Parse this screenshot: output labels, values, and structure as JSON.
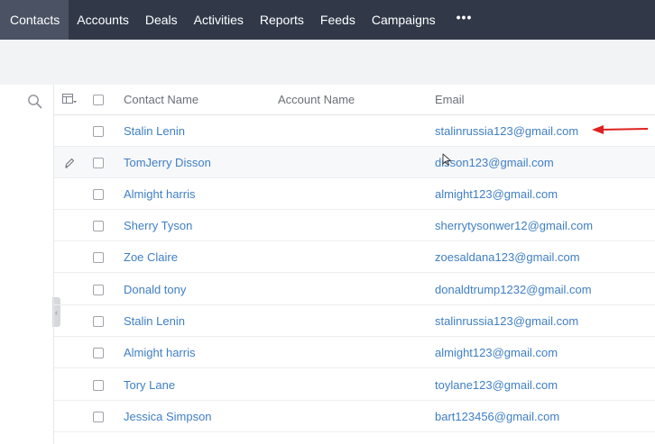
{
  "nav": {
    "items": [
      "Contacts",
      "Accounts",
      "Deals",
      "Activities",
      "Reports",
      "Feeds",
      "Campaigns"
    ],
    "more": "•••"
  },
  "table": {
    "headers": {
      "contact_name": "Contact Name",
      "account_name": "Account Name",
      "email": "Email"
    },
    "rows": [
      {
        "name": "Stalin Lenin",
        "email": "stalinrussia123@gmail.com"
      },
      {
        "name": "TomJerry Disson",
        "email": "disson123@gmail.com"
      },
      {
        "name": "Almight harris",
        "email": "almight123@gmail.com"
      },
      {
        "name": "Sherry Tyson",
        "email": "sherrytysonwer12@gmail.com"
      },
      {
        "name": "Zoe Claire",
        "email": "zoesaldana123@gmail.com"
      },
      {
        "name": "Donald tony",
        "email": "donaldtrump1232@gmail.com"
      },
      {
        "name": "Stalin Lenin",
        "email": "stalinrussia123@gmail.com"
      },
      {
        "name": "Almight harris",
        "email": "almight123@gmail.com"
      },
      {
        "name": "Tory Lane",
        "email": "toylane123@gmail.com"
      },
      {
        "name": "Jessica Simpson",
        "email": "bart123456@gmail.com"
      }
    ]
  },
  "colors": {
    "nav_bg": "#313949",
    "nav_active": "#4a5263",
    "link": "#3f7fc4",
    "arrow": "#e02020"
  }
}
